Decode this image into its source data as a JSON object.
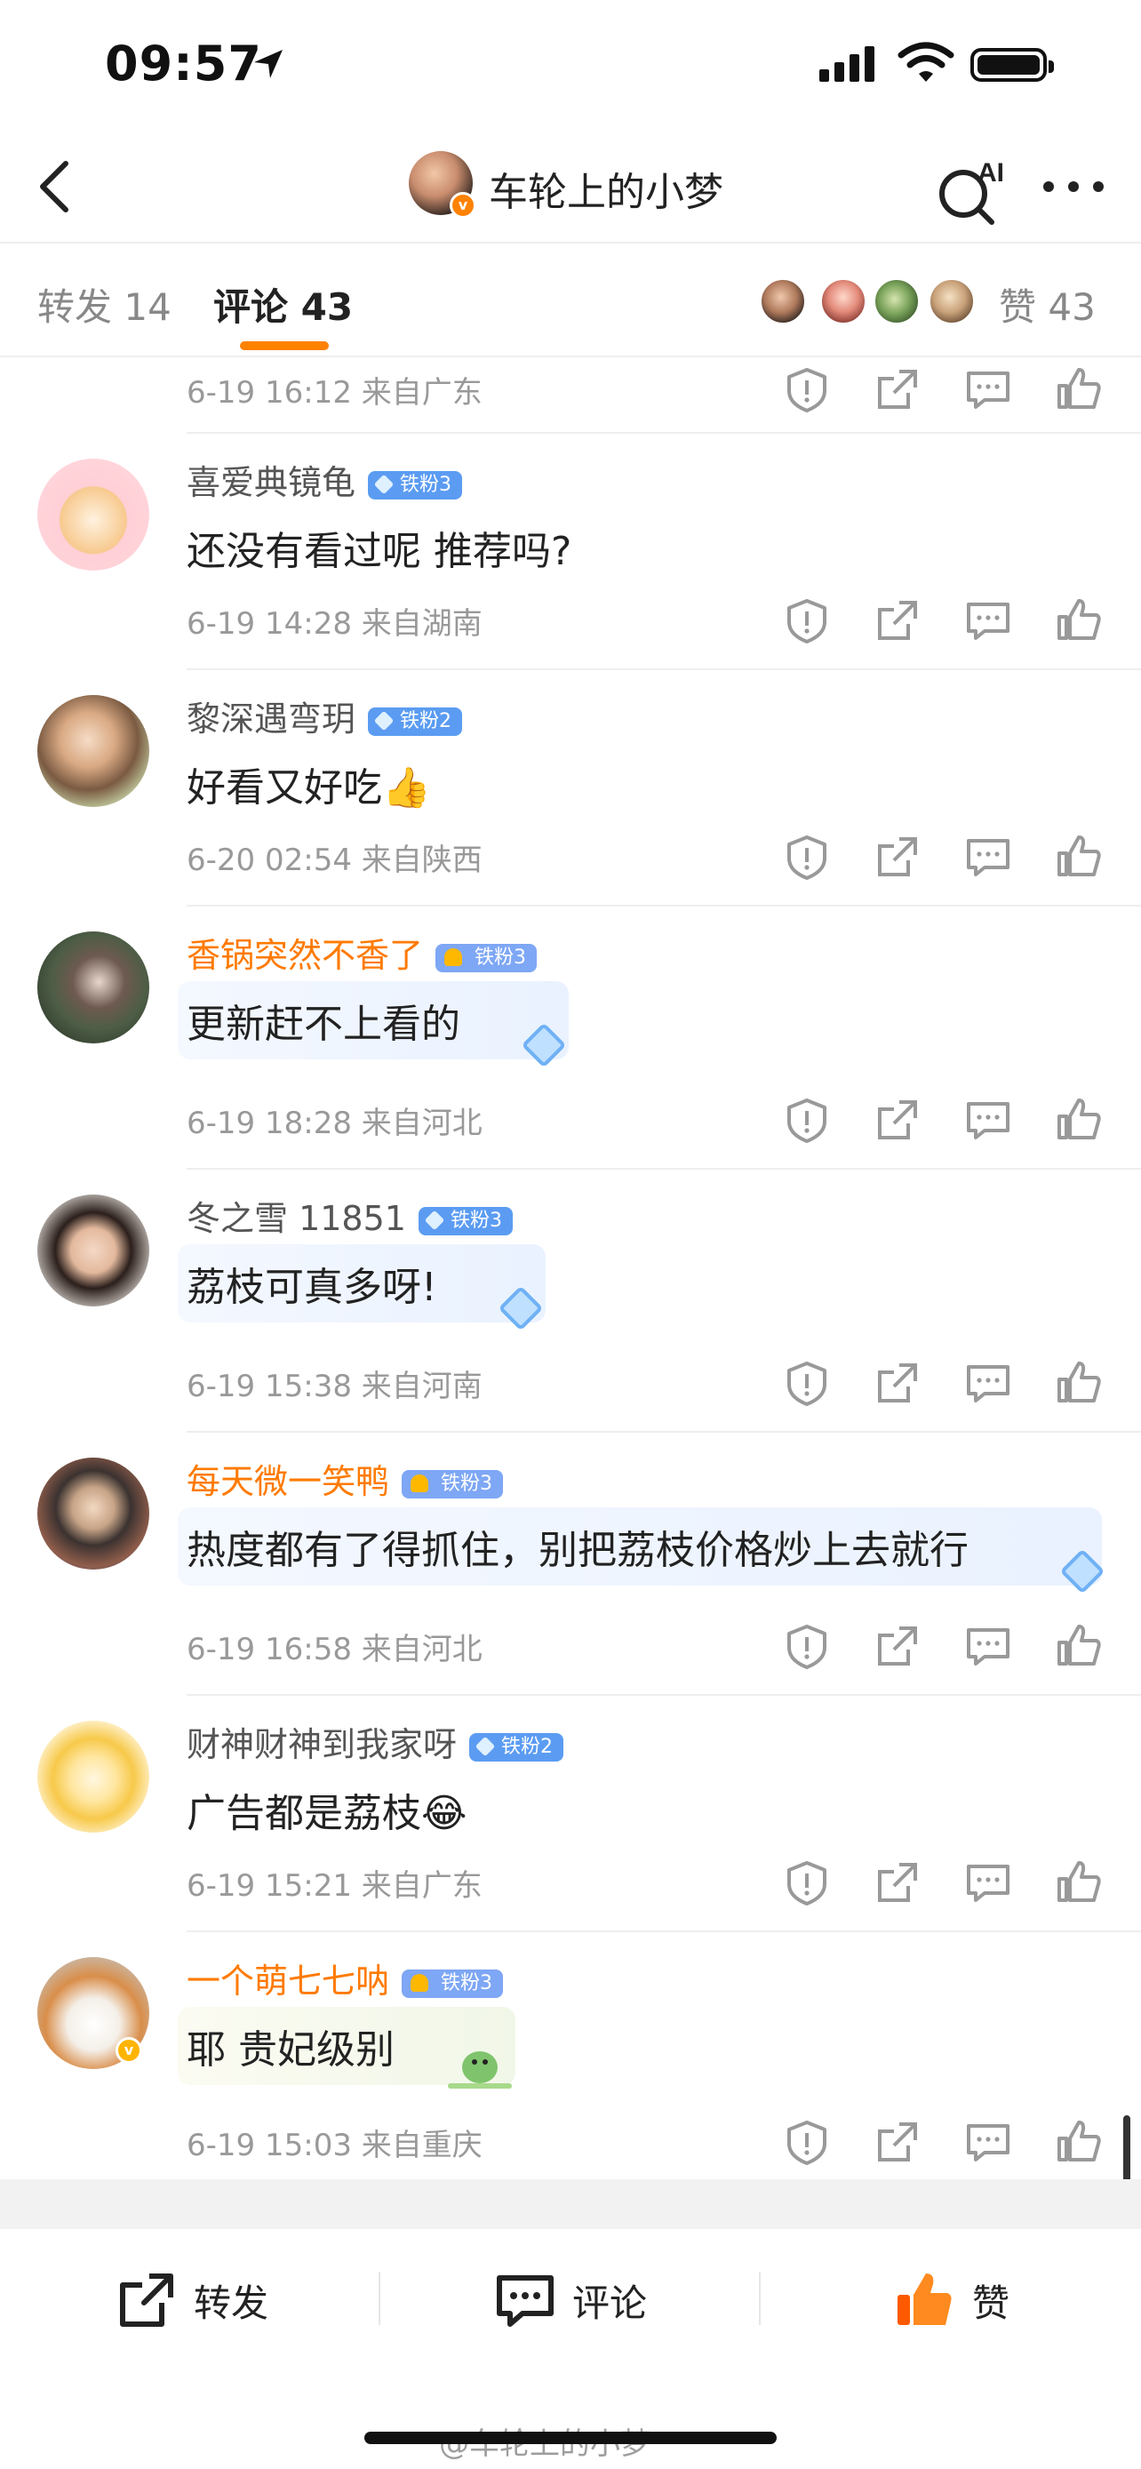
{
  "status_bar": {
    "time": "09:57"
  },
  "nav": {
    "title": "车轮上的小梦",
    "ai_label": "AI"
  },
  "tabs": {
    "repost": "转发 14",
    "comment": "评论 43",
    "likes": "赞 43"
  },
  "first_meta": "6-19 16:12  来自广东",
  "comments": [
    {
      "user": "喜爱典镜龟",
      "badge": "铁粉3",
      "vip": false,
      "text": "还没有看过呢 推荐吗?",
      "meta": "6-19 14:28  来自湖南",
      "avatar_icon": "tiger-avatar"
    },
    {
      "user": "黎深遇弯玥",
      "badge": "铁粉2",
      "vip": false,
      "text": "好看又好吃👍",
      "meta": "6-20 02:54  来自陕西",
      "avatar_icon": "girl-avatar"
    },
    {
      "user": "香锅突然不香了",
      "badge": "铁粉3",
      "vip": true,
      "text": "更新赶不上看的",
      "meta": "6-19 18:28  来自河北",
      "avatar_icon": "outdoor-avatar"
    },
    {
      "user": "冬之雪 11851",
      "badge": "铁粉3",
      "vip": false,
      "text": "荔枝可真多呀!",
      "meta": "6-19 15:38  来自河南",
      "avatar_icon": "doll-avatar"
    },
    {
      "user": "每天微一笑鸭",
      "badge": "铁粉3",
      "vip": true,
      "text": "热度都有了得抓住，别把荔枝价格炒上去就行",
      "meta": "6-19 16:58  来自河北",
      "avatar_icon": "anime-avatar"
    },
    {
      "user": "财神财神到我家呀",
      "badge": "铁粉2",
      "vip": false,
      "text": "广告都是荔枝😂",
      "meta": "6-19 15:21  来自广东",
      "avatar_icon": "cat-coin-avatar"
    },
    {
      "user": "一个萌七七呐",
      "badge": "铁粉3",
      "vip": true,
      "text": "耶  贵妃级别",
      "meta": "6-19 15:03  来自重庆",
      "avatar_icon": "kitten-avatar"
    }
  ],
  "bottom": {
    "repost": "转发",
    "comment": "评论",
    "like": "赞"
  },
  "watermark": "@车轮上的小梦",
  "colors": {
    "accent": "#ff8200",
    "vip_name": "#ff7a00",
    "fan_badge": "#5b9cf2"
  }
}
